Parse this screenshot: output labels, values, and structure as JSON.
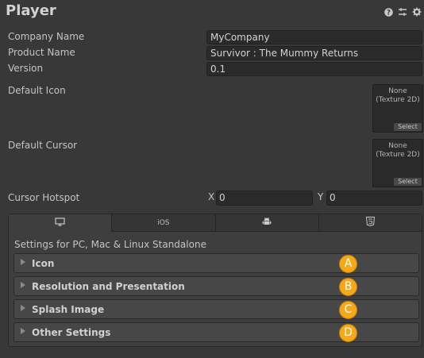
{
  "header": {
    "title": "Player",
    "icons": [
      "help-icon",
      "preset-icon",
      "gear-icon"
    ]
  },
  "fields": {
    "company_label": "Company Name",
    "company_value": "MyCompany",
    "product_label": "Product Name",
    "product_value": "Survivor : The Mummy Returns",
    "version_label": "Version",
    "version_value": "0.1",
    "default_icon_label": "Default Icon",
    "default_cursor_label": "Default Cursor",
    "texture_none": "None",
    "texture_type": "(Texture 2D)",
    "select_label": "Select",
    "hotspot_label": "Cursor Hotspot",
    "hotspot_x_label": "X",
    "hotspot_x": "0",
    "hotspot_y_label": "Y",
    "hotspot_y": "0"
  },
  "platform": {
    "tabs": [
      {
        "icon": "monitor-icon",
        "label": ""
      },
      {
        "icon": "",
        "label": "iOS"
      },
      {
        "icon": "android-icon",
        "label": ""
      },
      {
        "icon": "html5-icon",
        "label": ""
      }
    ],
    "settings_for": "Settings for PC, Mac & Linux Standalone",
    "sections": [
      {
        "label": "Icon",
        "badge": "A"
      },
      {
        "label": "Resolution and Presentation",
        "badge": "B"
      },
      {
        "label": "Splash Image",
        "badge": "C"
      },
      {
        "label": "Other Settings",
        "badge": "D"
      }
    ]
  },
  "colors": {
    "background": "#383838",
    "badge": "#f5a91a"
  }
}
